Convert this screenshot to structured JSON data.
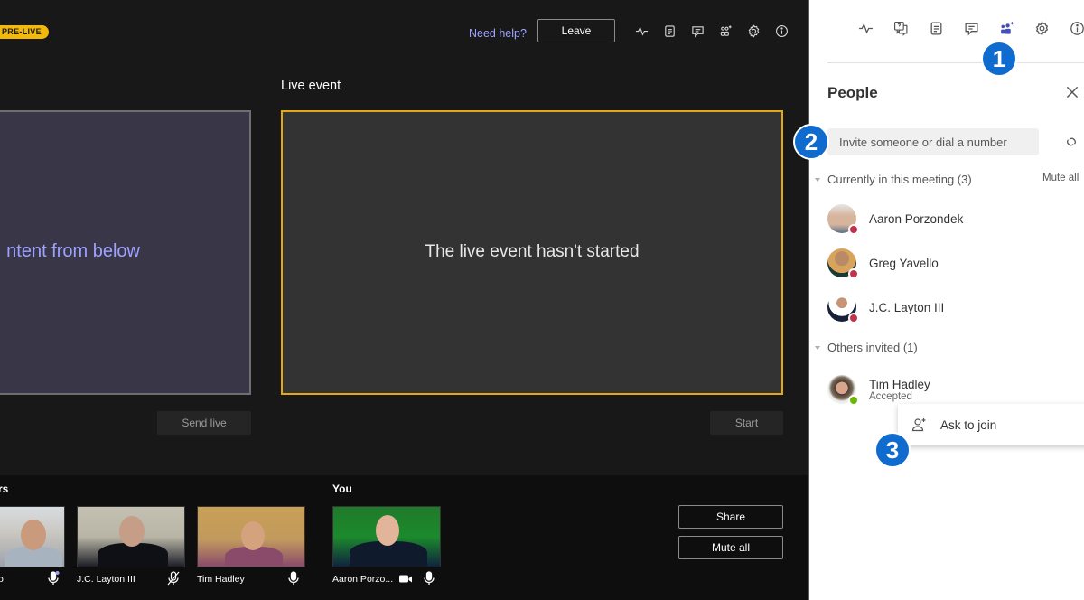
{
  "header": {
    "status_badge": "PRE-LIVE",
    "need_help": "Need help?",
    "leave_label": "Leave",
    "toolbar_icons": [
      "health-icon",
      "notes-icon",
      "chat-icon",
      "people-add-icon",
      "settings-icon",
      "info-icon"
    ]
  },
  "stage": {
    "preview_text": "ntent from below",
    "send_live_label": "Send live",
    "live_event_label": "Live event",
    "live_event_text": "The live event hasn't started",
    "start_label": "Start"
  },
  "bottom": {
    "presenters_label": "rs",
    "you_label": "You",
    "tiles": [
      {
        "name": "o",
        "mic": "mic-speaking"
      },
      {
        "name": "J.C. Layton III",
        "mic": "mic-muted"
      },
      {
        "name": "Tim Hadley",
        "mic": "mic-on"
      }
    ],
    "you_tile": {
      "name": "Aaron Porzo...",
      "camera": "camera-on",
      "mic": "mic-on"
    },
    "share_label": "Share",
    "mute_all_label": "Mute all"
  },
  "panel": {
    "toolbar_icons": [
      "health-icon",
      "qa-icon",
      "notes-icon",
      "chat-icon",
      "people-icon",
      "settings-icon",
      "info-icon"
    ],
    "active_icon": "people-icon",
    "title": "People",
    "invite_placeholder": "Invite someone or dial a number",
    "in_meeting_header": "Currently in this meeting (3)",
    "mute_all_label": "Mute all",
    "in_meeting": [
      {
        "name": "Aaron Porzondek",
        "status": "busy"
      },
      {
        "name": "Greg Yavello",
        "status": "busy"
      },
      {
        "name": "J.C. Layton III",
        "status": "busy"
      }
    ],
    "invited_header": "Others invited (1)",
    "invited": [
      {
        "name": "Tim Hadley",
        "sub": "Accepted",
        "status": "available"
      }
    ],
    "context_menu": {
      "label": "Ask to join"
    }
  },
  "callouts": [
    "1",
    "2",
    "3"
  ],
  "colors": {
    "badge": "#f2b80c",
    "live_border": "#e2a912",
    "accent": "#9ea2ff",
    "callout": "#0f6cce",
    "busy": "#c4314b",
    "available": "#6bb700"
  }
}
